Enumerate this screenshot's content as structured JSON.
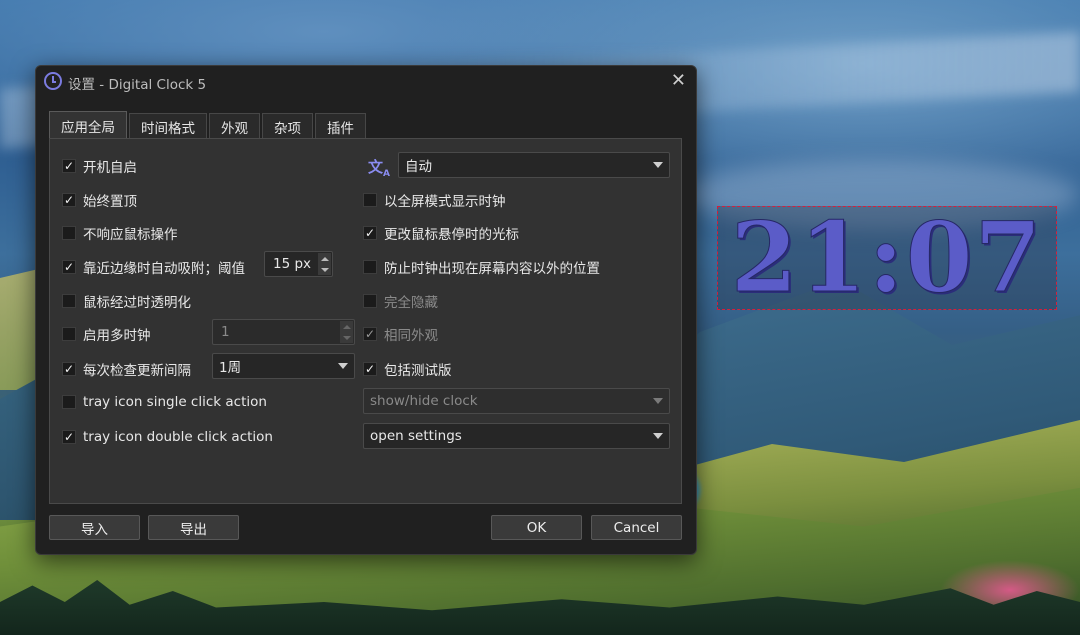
{
  "window": {
    "title": "设置 - Digital Clock 5",
    "close_glyph": "✕"
  },
  "tabs": [
    {
      "label": "应用全局",
      "active": true
    },
    {
      "label": "时间格式",
      "active": false
    },
    {
      "label": "外观",
      "active": false
    },
    {
      "label": "杂项",
      "active": false
    },
    {
      "label": "插件",
      "active": false
    }
  ],
  "left_options": [
    {
      "label": "开机自启",
      "checked": true
    },
    {
      "label": "始终置顶",
      "checked": true
    },
    {
      "label": "不响应鼠标操作",
      "checked": false
    },
    {
      "label": "靠近边缘时自动吸附；阈值",
      "checked": true
    },
    {
      "label": "鼠标经过时透明化",
      "checked": false
    },
    {
      "label": "启用多时钟",
      "checked": false
    },
    {
      "label": "每次检查更新间隔",
      "checked": true
    },
    {
      "label": "tray icon single click action",
      "checked": false
    },
    {
      "label": "tray icon double click action",
      "checked": true
    }
  ],
  "snap_threshold": {
    "value": "15 px"
  },
  "multi_clock_count": {
    "value": "1",
    "enabled": false
  },
  "update_interval": {
    "value": "1周"
  },
  "language": {
    "icon": "translate-icon",
    "value": "自动"
  },
  "right_options": [
    {
      "label": "以全屏模式显示时钟",
      "checked": false,
      "enabled": true
    },
    {
      "label": "更改鼠标悬停时的光标",
      "checked": true,
      "enabled": true
    },
    {
      "label": "防止时钟出现在屏幕内容以外的位置",
      "checked": false,
      "enabled": true
    },
    {
      "label": "完全隐藏",
      "checked": false,
      "enabled": false
    },
    {
      "label": "相同外观",
      "checked": true,
      "enabled": false
    },
    {
      "label": "包括测试版",
      "checked": true,
      "enabled": true
    }
  ],
  "tray_single_action": {
    "value": "show/hide clock",
    "enabled": false
  },
  "tray_double_action": {
    "value": "open settings",
    "enabled": true
  },
  "buttons": {
    "import": "导入",
    "export": "导出",
    "ok": "OK",
    "cancel": "Cancel"
  },
  "clock": {
    "time": "21:07",
    "color": "#5b5cc8",
    "border_color": "#d61f3c"
  },
  "check_glyph": "✓"
}
